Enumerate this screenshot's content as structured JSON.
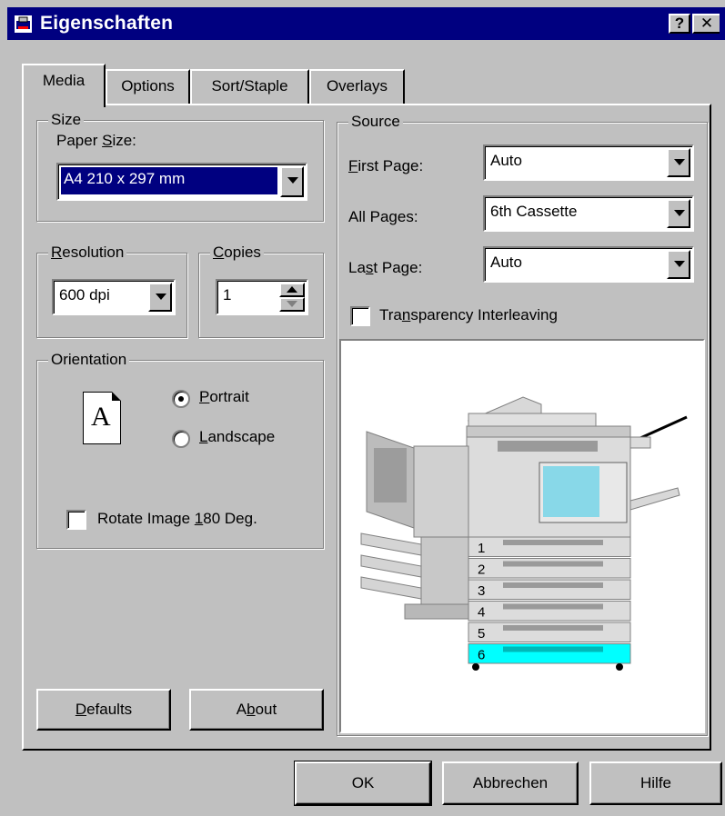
{
  "window": {
    "title": "Eigenschaften",
    "help_glyph": "?",
    "close_glyph": "✕"
  },
  "tabs": [
    {
      "label": "Media",
      "active": true
    },
    {
      "label": "Options",
      "active": false
    },
    {
      "label": "Sort/Staple",
      "active": false
    },
    {
      "label": "Overlays",
      "active": false
    }
  ],
  "size": {
    "group_label": "Size",
    "paper_size_label_pre": "Paper ",
    "paper_size_label_u": "S",
    "paper_size_label_post": "ize:",
    "paper_size_value": "A4 210 x 297 mm"
  },
  "resolution": {
    "group_label_u": "R",
    "group_label_rest": "esolution",
    "value": "600 dpi"
  },
  "copies": {
    "group_label_u": "C",
    "group_label_rest": "opies",
    "value": "1"
  },
  "orientation": {
    "group_label": "Orientation",
    "page_glyph": "A",
    "portrait_u": "P",
    "portrait_rest": "ortrait",
    "portrait_selected": true,
    "landscape_u": "L",
    "landscape_rest": "andscape",
    "landscape_selected": false,
    "rotate_pre": "Rotate Image ",
    "rotate_u": "1",
    "rotate_post": "80 Deg.",
    "rotate_checked": false
  },
  "source": {
    "group_label": "Source",
    "first_page_u": "F",
    "first_page_rest": "irst Page:",
    "first_page_value": "Auto",
    "all_pages_label": "All Pages:",
    "all_pages_value": "6th Cassette",
    "last_page_pre": "La",
    "last_page_u": "s",
    "last_page_post": "t Page:",
    "last_page_value": "Auto",
    "transparency_pre": "Tra",
    "transparency_u": "n",
    "transparency_post": "sparency Interleaving",
    "transparency_checked": false
  },
  "printer": {
    "trays": [
      "1",
      "2",
      "3",
      "4",
      "5",
      "6"
    ],
    "selected_tray": "6",
    "highlight_color": "#00ffff"
  },
  "buttons": {
    "defaults_u": "D",
    "defaults_rest": "efaults",
    "about_pre": "A",
    "about_u": "b",
    "about_post": "out",
    "ok": "OK",
    "cancel": "Abbrechen",
    "help": "Hilfe"
  },
  "colors": {
    "titlebar": "#000080",
    "face": "#c0c0c0",
    "selection": "#000080"
  }
}
